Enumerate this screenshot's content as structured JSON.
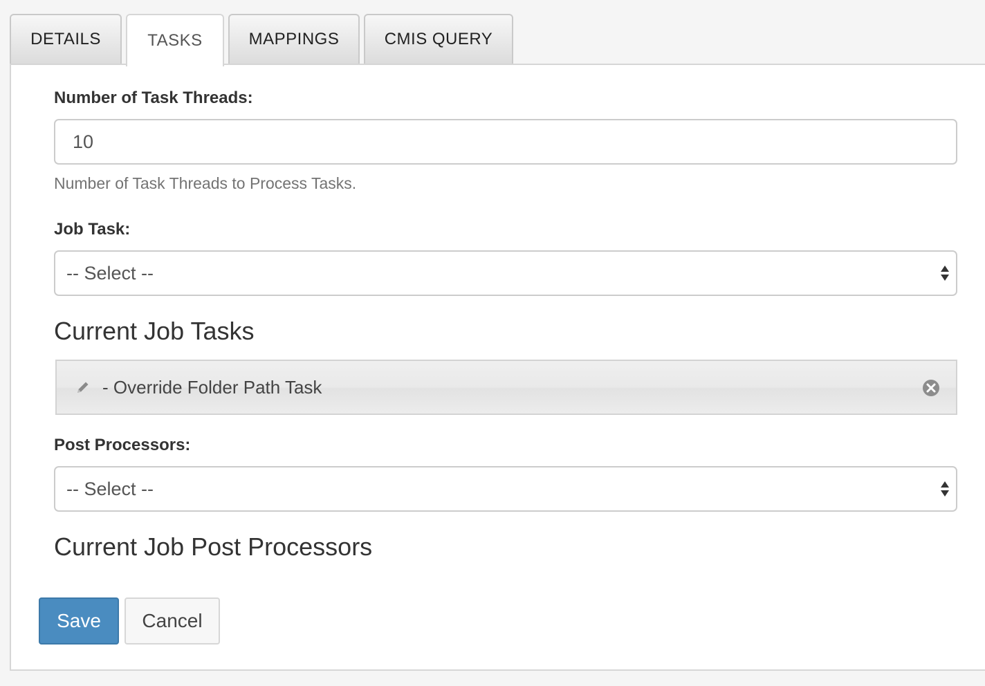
{
  "tabs": [
    {
      "label": "DETAILS",
      "active": false
    },
    {
      "label": "TASKS",
      "active": true
    },
    {
      "label": "MAPPINGS",
      "active": false
    },
    {
      "label": "CMIS QUERY",
      "active": false
    }
  ],
  "form": {
    "task_threads": {
      "label": "Number of Task Threads:",
      "value": "10",
      "help": "Number of Task Threads to Process Tasks."
    },
    "job_task": {
      "label": "Job Task:",
      "selected": "-- Select --"
    },
    "current_job_tasks": {
      "title": "Current Job Tasks",
      "items": [
        {
          "label": "- Override Folder Path Task",
          "icon": "pencil-icon",
          "remove_icon": "remove-circle-icon"
        }
      ]
    },
    "post_processors": {
      "label": "Post Processors:",
      "selected": "-- Select --"
    },
    "current_post_processors": {
      "title": "Current Job Post Processors",
      "items": []
    }
  },
  "buttons": {
    "save_label": "Save",
    "cancel_label": "Cancel"
  },
  "colors": {
    "primary": "#4a8cc0",
    "page_background": "#f5f5f5",
    "panel_background": "#ffffff"
  }
}
